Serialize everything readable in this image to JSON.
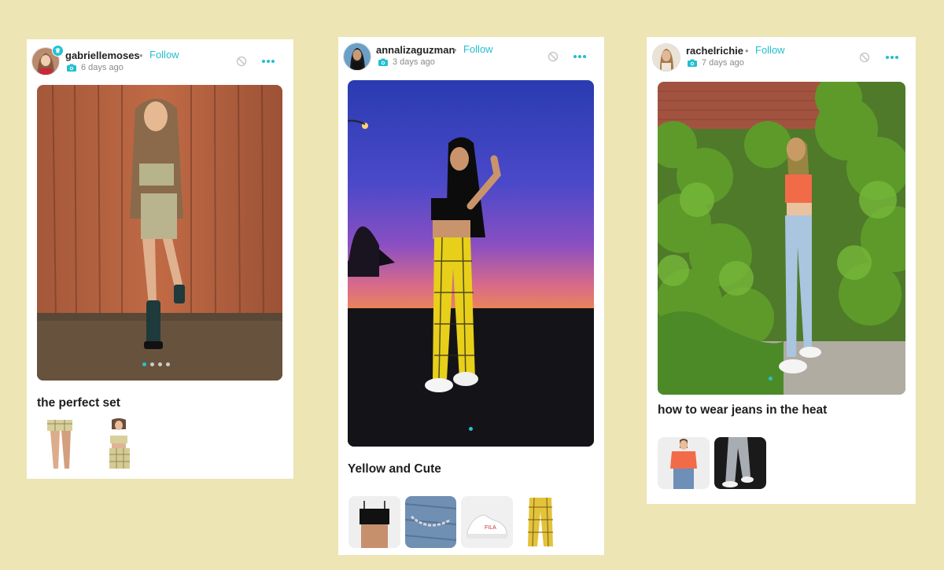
{
  "colors": {
    "background": "#EEE5B5",
    "accent": "#22BFD0",
    "card": "#FFFFFF"
  },
  "posts": [
    {
      "username": "gabriellemoses",
      "follow_label": "Follow",
      "separator": "•",
      "time": "6 days ago",
      "verified": true,
      "caption": "the perfect set",
      "carousel_count": 4,
      "carousel_active": 1,
      "products": [
        "plaid-skirt",
        "plaid-crop-set"
      ]
    },
    {
      "username": "annalizaguzman",
      "follow_label": "Follow",
      "separator": "•",
      "time": "3 days ago",
      "verified": false,
      "caption": "Yellow and Cute",
      "carousel_count": 1,
      "carousel_active": 1,
      "products": [
        "black-crop-top",
        "chain-accessory",
        "white-sneakers",
        "yellow-plaid-pants"
      ]
    },
    {
      "username": "rachelrichie",
      "follow_label": "Follow",
      "separator": "•",
      "time": "7 days ago",
      "verified": false,
      "caption": "how to wear jeans in the heat",
      "carousel_count": 1,
      "carousel_active": 1,
      "products": [
        "orange-tie-top",
        "grey-jeans"
      ]
    }
  ],
  "icons": {
    "camera": "camera-icon",
    "block": "block-icon",
    "more": "more-options-icon"
  }
}
